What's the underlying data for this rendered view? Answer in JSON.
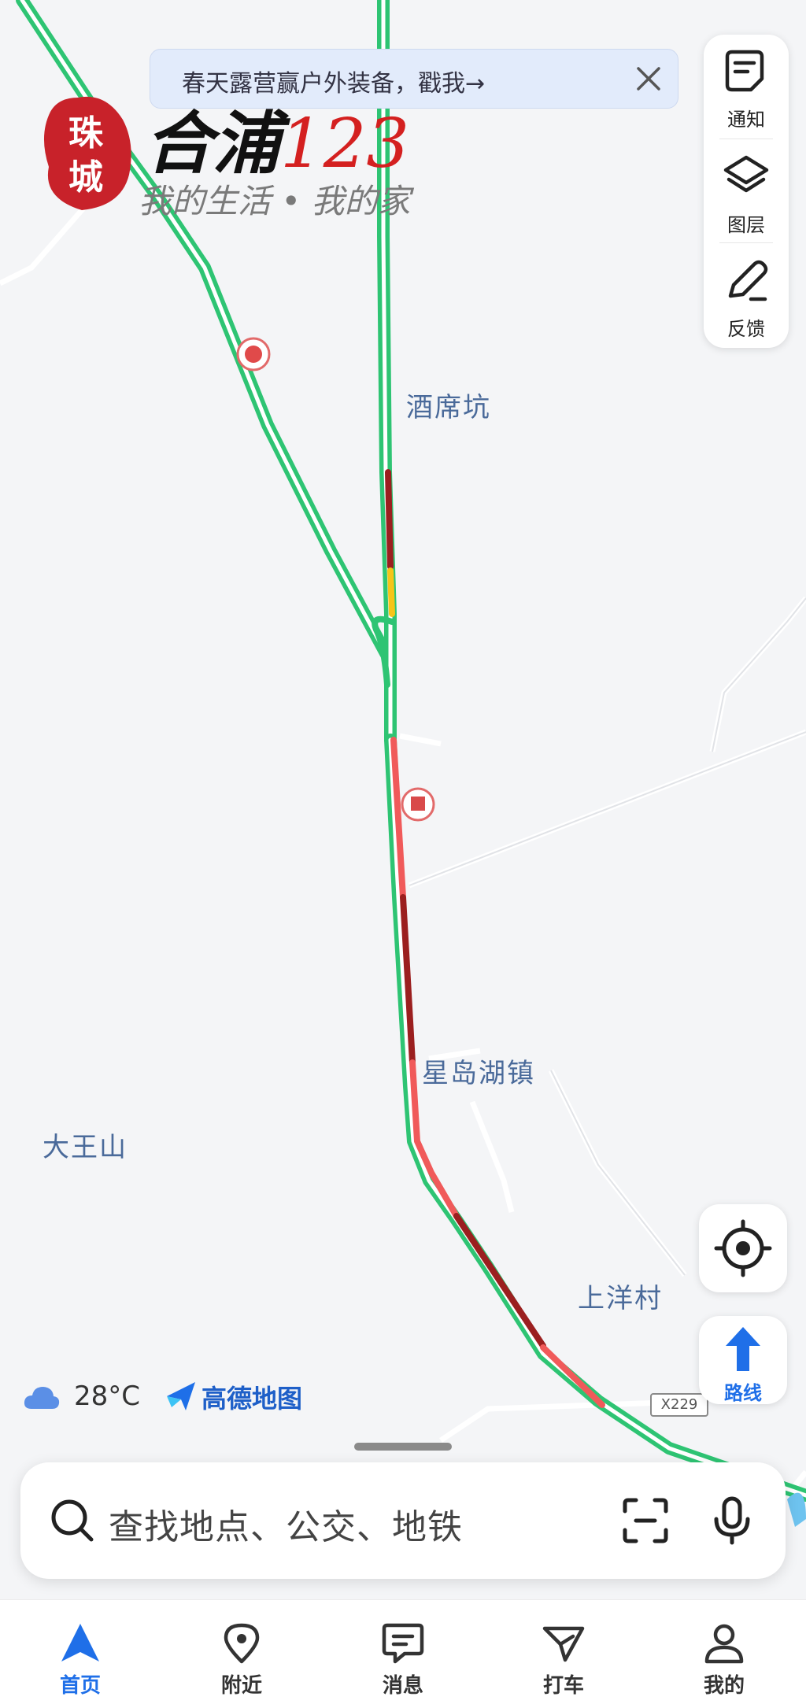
{
  "banner": {
    "text": "春天露营赢户外装备，戳我→"
  },
  "watermark": {
    "seal": "珠城",
    "title": "合浦",
    "number": "123",
    "subtitle": "我的生活 • 我的家"
  },
  "side_panel": {
    "items": [
      {
        "label": "通知",
        "icon": "notice-icon"
      },
      {
        "label": "图层",
        "icon": "layers-icon"
      },
      {
        "label": "反馈",
        "icon": "feedback-icon"
      }
    ]
  },
  "map": {
    "labels": {
      "jiuxikeng": "酒席坑",
      "xingdaohu": "星岛湖镇",
      "dawangshan": "大王山",
      "shangyang": "上洋村"
    },
    "road_shield": "X229"
  },
  "controls": {
    "route_label": "路线"
  },
  "weather": {
    "icon": "cloud-icon",
    "temp": "28°C"
  },
  "attribution": {
    "text": "高德地图"
  },
  "search": {
    "placeholder": "查找地点、公交、地铁"
  },
  "tabs": [
    {
      "label": "首页",
      "active": true
    },
    {
      "label": "附近"
    },
    {
      "label": "消息"
    },
    {
      "label": "打车"
    },
    {
      "label": "我的"
    }
  ],
  "colors": {
    "accent": "#1f6fe8",
    "traffic_green": "#2ec473",
    "traffic_red": "#f05a5a",
    "traffic_darkred": "#9b1f1f",
    "traffic_yellow": "#f5c518"
  }
}
